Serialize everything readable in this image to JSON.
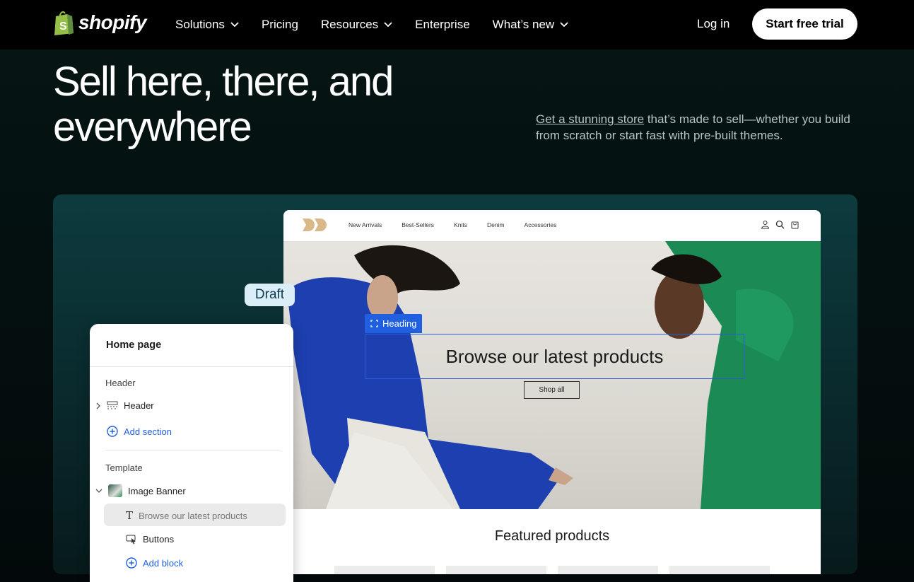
{
  "nav": {
    "brand": "shopify",
    "items": [
      {
        "label": "Solutions",
        "dropdown": true
      },
      {
        "label": "Pricing",
        "dropdown": false
      },
      {
        "label": "Resources",
        "dropdown": true
      },
      {
        "label": "Enterprise",
        "dropdown": false
      },
      {
        "label": "What’s new",
        "dropdown": true
      }
    ],
    "login": "Log in",
    "cta": "Start free trial"
  },
  "hero": {
    "title": "Sell here, there, and everywhere",
    "sub_link": "Get a stunning store",
    "sub_rest": " that’s made to sell—whether you build from scratch or start fast with pre-built themes."
  },
  "store": {
    "links": [
      "New Arrivals",
      "Best-Sellers",
      "Knits",
      "Denim",
      "Accessories"
    ],
    "heading_tag": "Heading",
    "banner_heading": "Browse our latest products",
    "shop_button": "Shop all",
    "featured": "Featured products"
  },
  "draft_badge": "Draft",
  "editor": {
    "title": "Home page",
    "header_section": "Header",
    "header_item": "Header",
    "add_section": "Add section",
    "template_section": "Template",
    "image_banner": "Image Banner",
    "block_heading": "Browse our latest products",
    "block_buttons": "Buttons",
    "add_block": "Add block"
  },
  "colors": {
    "shopify_green": "#95bf47",
    "editor_blue": "#1f5fe0",
    "draft_bg": "#dbeef7"
  }
}
